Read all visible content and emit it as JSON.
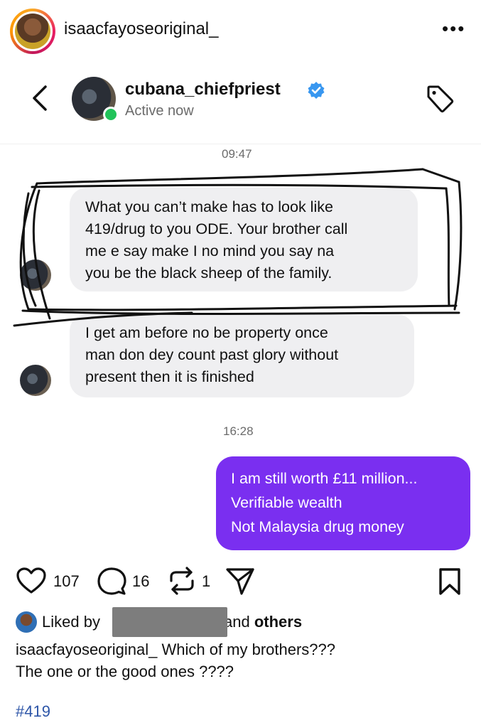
{
  "post": {
    "username": "isaacfayoseoriginal_",
    "more": "•••"
  },
  "dm": {
    "username": "cubana_chiefpriest",
    "status": "Active now",
    "times": [
      "09:47",
      "16:28"
    ],
    "messages_in": [
      {
        "lines": [
          "What you can’t make has to  look like",
          "419/drug to you ODE. Your brother call",
          "me e say make I no mind you say na",
          "you be the black sheep of the family."
        ]
      },
      {
        "lines": [
          "I get am before no be property once",
          "man don dey count past glory without",
          "present then it is finished"
        ]
      }
    ],
    "message_out": {
      "lines": [
        "I am still worth £11 million...",
        "Verifiable wealth",
        "Not Malaysia drug money"
      ]
    }
  },
  "actions": {
    "likes": "107",
    "comments": "16",
    "reposts": "1"
  },
  "liked_by": {
    "prefix": "Liked by",
    "suffix_and": "and",
    "suffix_others": "others"
  },
  "caption": {
    "username": "isaacfayoseoriginal_",
    "line1": "Which of my brothers???",
    "line2": "The one or the good ones ????"
  },
  "hashtag": "#419",
  "colors": {
    "accent_purple": "#7a2ff0",
    "verified_blue": "#3897f0",
    "online_green": "#21c35a",
    "hashtag_blue": "#2e56a8"
  },
  "icons": [
    "more-icon",
    "back-chevron-icon",
    "verified-badge-icon",
    "tag-icon",
    "heart-icon",
    "comment-icon",
    "repost-icon",
    "share-icon",
    "bookmark-icon"
  ]
}
